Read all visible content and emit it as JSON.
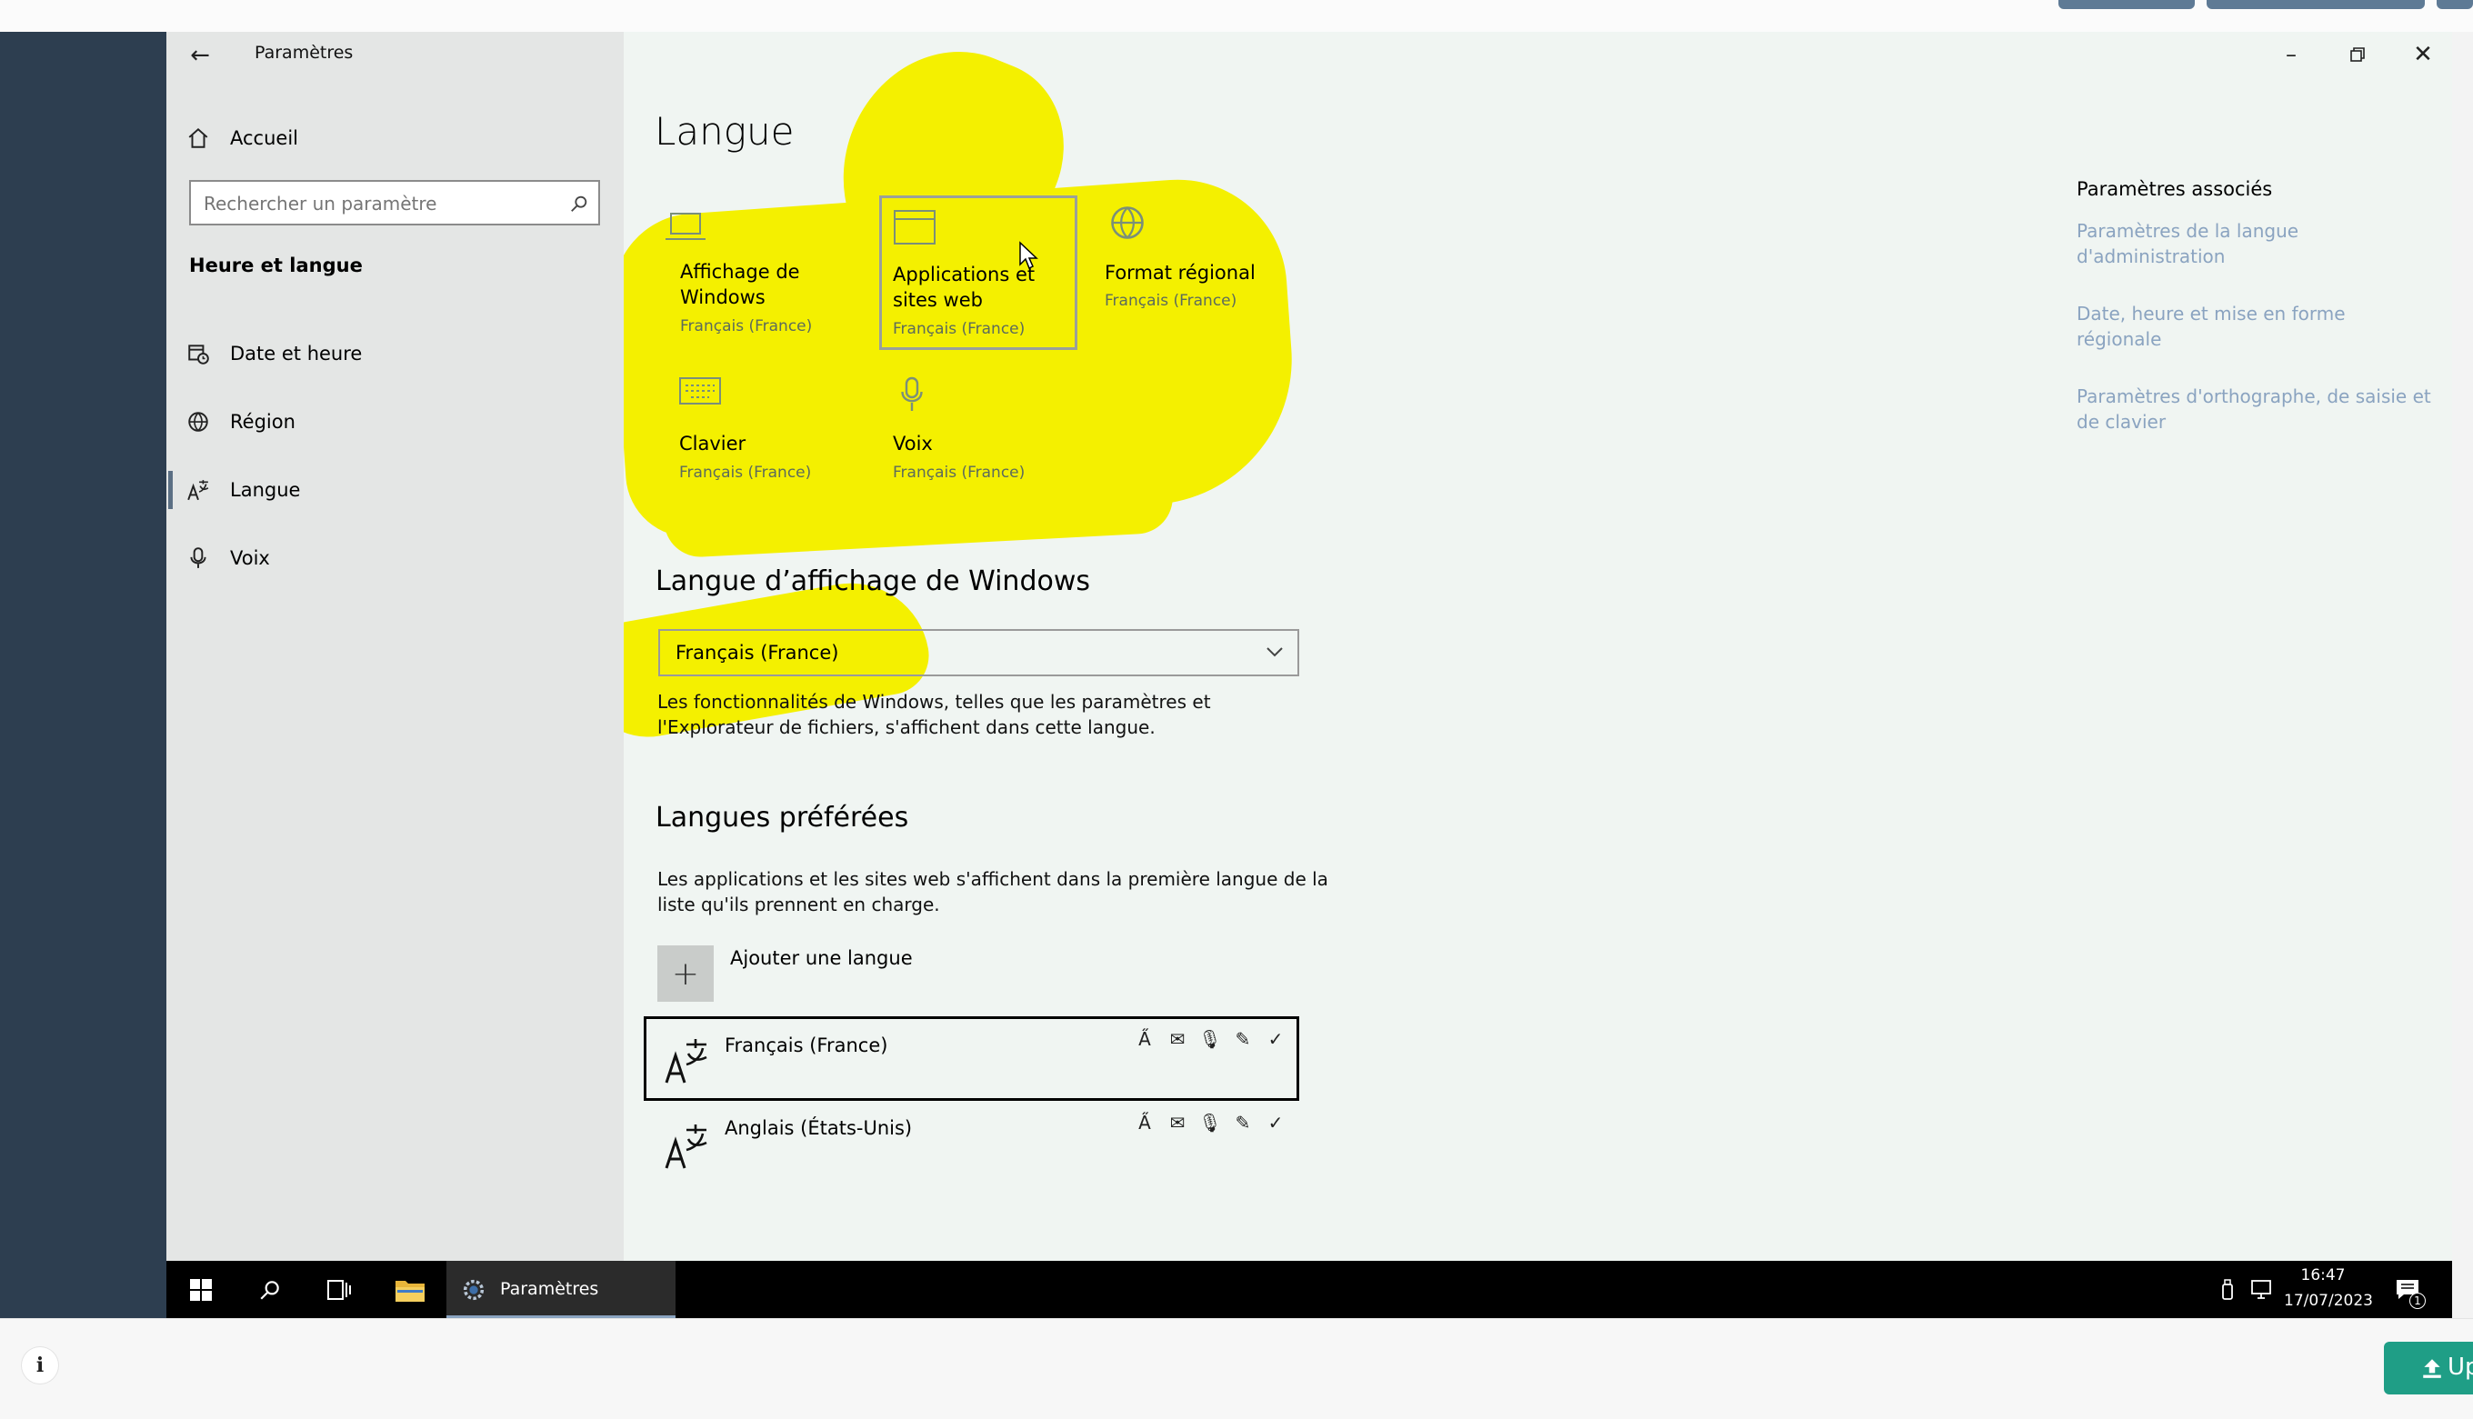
{
  "window": {
    "title": "Paramètres"
  },
  "sidebar": {
    "home": "Accueil",
    "search_placeholder": "Rechercher un paramètre",
    "section_title": "Heure et langue",
    "items": [
      {
        "label": "Date et heure",
        "icon": "calendar-clock-icon"
      },
      {
        "label": "Région",
        "icon": "globe-icon"
      },
      {
        "label": "Langue",
        "icon": "language-icon",
        "selected": true
      },
      {
        "label": "Voix",
        "icon": "microphone-icon"
      }
    ]
  },
  "page": {
    "title": "Langue"
  },
  "tiles": [
    {
      "title": "Affichage de Windows",
      "title_line1": "Affichage de",
      "title_line2": "Windows",
      "sub": "Français (France)",
      "icon": "laptop-icon"
    },
    {
      "title": "Applications et sites web",
      "title_line1": "Applications et",
      "title_line2": "sites web",
      "sub": "Français (France)",
      "icon": "window-icon"
    },
    {
      "title": "Format régional",
      "sub": "Français (France)",
      "icon": "globe-icon"
    },
    {
      "title": "Clavier",
      "sub": "Français (France)",
      "icon": "keyboard-icon"
    },
    {
      "title": "Voix",
      "sub": "Français (France)",
      "icon": "microphone-icon"
    }
  ],
  "display_language": {
    "heading": "Langue d’affichage de Windows",
    "selected": "Français (France)",
    "desc_line1": "Les fonctionnalités de Windows, telles que les paramètres et",
    "desc_line2": "l'Explorateur de fichiers, s'affichent dans cette langue."
  },
  "preferred": {
    "heading": "Langues préférées",
    "desc_line1": "Les applications et les sites web s'affichent dans la première langue de la",
    "desc_line2": "liste qu'ils prennent en charge.",
    "add_label": "Ajouter une langue",
    "languages": [
      {
        "name": "Français (France)",
        "selected": true
      },
      {
        "name": "Anglais (États-Unis)",
        "selected": false
      }
    ]
  },
  "related": {
    "heading": "Paramètres associés",
    "links": [
      {
        "line1": "Paramètres de la langue",
        "line2": "d'administration"
      },
      {
        "line1": "Date, heure et mise en forme",
        "line2": "régionale"
      },
      {
        "line1": "Paramètres d'orthographe, de saisie et",
        "line2": "de clavier"
      }
    ]
  },
  "taskbar": {
    "app_label": "Paramètres",
    "time": "16:47",
    "date": "17/07/2023",
    "notification_count": "1"
  },
  "footer": {
    "upload_label": "Up",
    "info_icon": "info-icon"
  },
  "colors": {
    "highlight": "#f4f000",
    "upload": "#1f9e86",
    "link": "#8aa3c0",
    "sidebar": "#e4e6e5"
  }
}
